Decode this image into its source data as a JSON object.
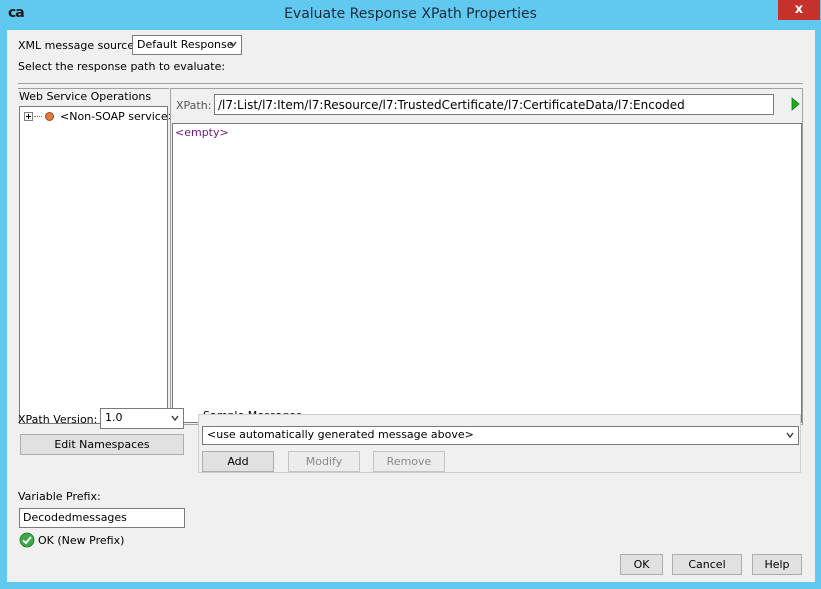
{
  "window": {
    "logo": "ca",
    "title": "Evaluate Response XPath Properties",
    "close_label": "x"
  },
  "source": {
    "label": "XML message source:",
    "value": "Default Response"
  },
  "instruction": "Select the response path to evaluate:",
  "operations": {
    "header": "Web Service Operations",
    "tree_item": "<Non-SOAP service>"
  },
  "xpath": {
    "label": "XPath:",
    "value": "/l7:List/l7:Item/l7:Resource/l7:TrustedCertificate/l7:CertificateData/l7:Encoded",
    "result": "<empty>"
  },
  "xpath_version": {
    "label": "XPath Version:",
    "value": "1.0"
  },
  "edit_namespaces_label": "Edit Namespaces",
  "sample_messages": {
    "header": "Sample Messages",
    "selected": "<use automatically generated message above>",
    "add_label": "Add",
    "modify_label": "Modify",
    "remove_label": "Remove"
  },
  "variable_prefix": {
    "label": "Variable Prefix:",
    "value": "Decodedmessages",
    "status": "OK (New Prefix)"
  },
  "footer": {
    "ok_label": "OK",
    "cancel_label": "Cancel",
    "help_label": "Help"
  },
  "colors": {
    "titlebar": "#61c9ef",
    "close": "#c7312b",
    "ok_status": "#3aa845",
    "tree_node": "#e07a3c",
    "run_arrow": "#1fae1f"
  }
}
